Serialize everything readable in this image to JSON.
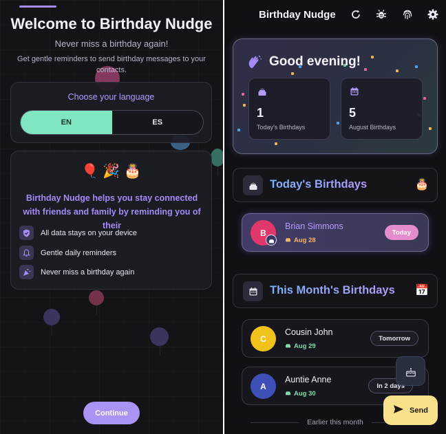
{
  "onboarding": {
    "title": "Welcome to Birthday Nudge",
    "subtitle": "Never miss a birthday again!",
    "description": "Get gentle reminders to send birthday messages to your contacts.",
    "language": {
      "title": "Choose your language",
      "options": [
        "EN",
        "ES"
      ],
      "selected": "EN"
    },
    "intro": {
      "emojis": [
        "🎈",
        "🎉",
        "🎂"
      ],
      "text": "Birthday Nudge helps you stay connected with friends and family by reminding you of their",
      "features": [
        {
          "icon": "shield-icon",
          "label": "All data stays on your device"
        },
        {
          "icon": "bell-icon",
          "label": "Gentle daily reminders"
        },
        {
          "icon": "party-popper-icon",
          "label": "Never miss a birthday again"
        }
      ]
    },
    "continue_label": "Continue",
    "accent_color": "#a78bfa",
    "toggle_color": "#7fe6c1"
  },
  "app": {
    "title": "Birthday Nudge",
    "toolbar_icons": [
      "refresh-icon",
      "bug-icon",
      "fingerprint-icon",
      "settings-icon"
    ],
    "greeting": "Good evening!",
    "stats": [
      {
        "icon": "cake-icon",
        "value": "1",
        "label": "Today's Birthdays"
      },
      {
        "icon": "calendar-icon",
        "value": "5",
        "label": "August Birthdays"
      }
    ],
    "today_section": {
      "title": "Today's Birthdays",
      "emoji": "🎂",
      "people": [
        {
          "initial": "B",
          "name": "Brian Simmons",
          "date": "Aug 28",
          "badge": "Today",
          "avatar_color": "#e0386a"
        }
      ]
    },
    "month_section": {
      "title": "This Month's Birthdays",
      "emoji": "📅",
      "people": [
        {
          "initial": "C",
          "name": "Cousin John",
          "date": "Aug 29",
          "badge": "Tomorrow",
          "avatar_color": "#f2c21c"
        },
        {
          "initial": "A",
          "name": "Auntie Anne",
          "date": "Aug 30",
          "badge": "In 2 days",
          "avatar_color": "#3f4fb8"
        }
      ]
    },
    "earlier_label": "Earlier this month",
    "send_label": "Send"
  }
}
